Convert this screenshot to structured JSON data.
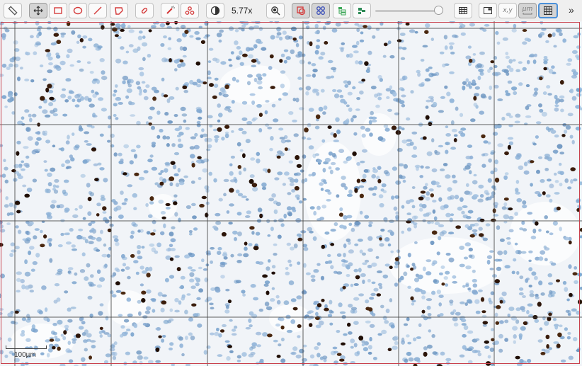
{
  "toolbar": {
    "tools": [
      {
        "id": "ruler",
        "icon": "ruler-icon"
      },
      {
        "id": "move",
        "icon": "move-icon",
        "active": true
      },
      {
        "id": "rectangle",
        "icon": "rectangle-icon"
      },
      {
        "id": "ellipse",
        "icon": "ellipse-icon"
      },
      {
        "id": "line",
        "icon": "line-icon"
      },
      {
        "id": "polygon",
        "icon": "polygon-icon"
      },
      {
        "id": "brush",
        "icon": "brush-icon"
      },
      {
        "id": "wand",
        "icon": "wand-icon"
      },
      {
        "id": "points",
        "icon": "points-icon"
      },
      {
        "id": "contrast",
        "icon": "contrast-icon"
      },
      {
        "id": "zoom-to-fit",
        "icon": "zoom-to-fit-icon"
      },
      {
        "id": "overlay-annotations",
        "icon": "overlay-icon",
        "active": true
      },
      {
        "id": "overlay-detections",
        "icon": "detections-icon",
        "active": true
      },
      {
        "id": "hierarchy",
        "icon": "hierarchy-icon"
      },
      {
        "id": "classify",
        "icon": "classify-icon"
      },
      {
        "id": "measurement-table",
        "icon": "table-icon"
      },
      {
        "id": "overview",
        "icon": "overview-icon"
      },
      {
        "id": "coordinates",
        "icon": "coordinates-icon"
      },
      {
        "id": "scalebar",
        "icon": "scalebar-icon"
      },
      {
        "id": "grid",
        "icon": "grid-icon",
        "active": true
      }
    ],
    "zoom_label": "5.77x",
    "coordinates_label": "x,y",
    "scalebar_label": "µm",
    "opacity_fraction": 0.93,
    "more_label": "»"
  },
  "viewer": {
    "scale_label": "100µm",
    "annotation_color": "#c9424e",
    "grid_color": "#444444",
    "hematoxylin_color": "#7ea6cf",
    "dab_color": "#2b1408"
  }
}
